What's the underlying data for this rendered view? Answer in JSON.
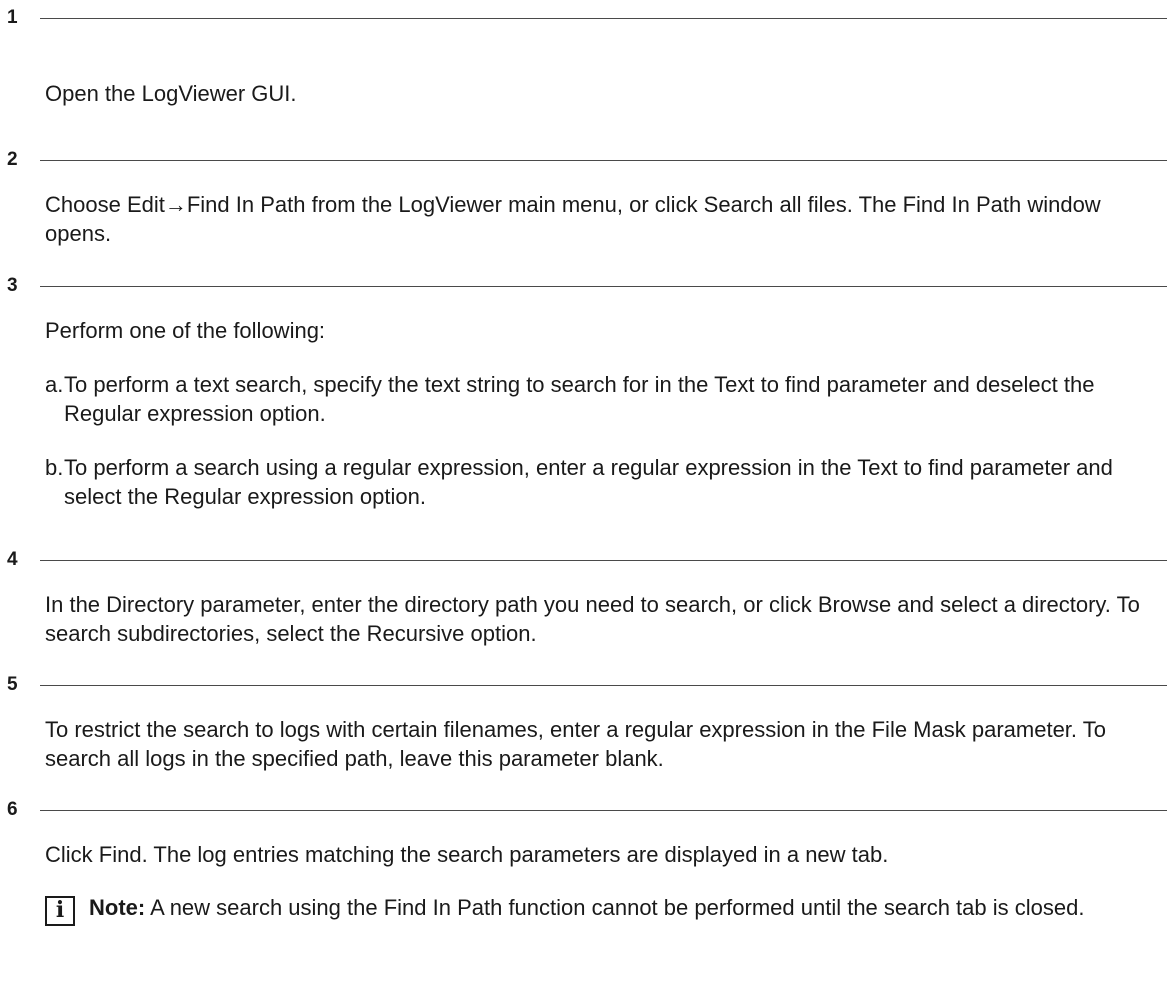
{
  "steps": [
    {
      "number": "1",
      "paragraphs": [
        "Open the LogViewer GUI."
      ]
    },
    {
      "number": "2",
      "paragraphs": [
        "Choose Edit→Find In Path from the LogViewer main menu, or click Search all files. The Find In Path window opens."
      ]
    },
    {
      "number": "3",
      "paragraphs": [
        "Perform one of the following:"
      ],
      "substeps": [
        {
          "marker": "a.",
          "text": "To perform a text search, specify the text string to search for in the Text to find parameter and deselect the Regular expression option."
        },
        {
          "marker": "b.",
          "text": "To perform a search using a regular expression, enter a regular expression in the Text to find parameter and select the Regular expression option."
        }
      ]
    },
    {
      "number": "4",
      "paragraphs": [
        "In the Directory parameter, enter the directory path you need to search, or click Browse and select a directory. To search subdirectories, select the Recursive option."
      ]
    },
    {
      "number": "5",
      "paragraphs": [
        "To restrict the search to logs with certain filenames, enter a regular expression in the File Mask parameter. To search all logs in the specified path, leave this parameter blank."
      ]
    },
    {
      "number": "6",
      "paragraphs": [
        "Click Find. The log entries matching the search parameters are displayed in a new tab."
      ],
      "note": {
        "icon": "info-icon",
        "icon_glyph": "i",
        "label": "Note:",
        "text": " A new search using the Find In Path function cannot be performed until the search tab is closed."
      }
    }
  ]
}
